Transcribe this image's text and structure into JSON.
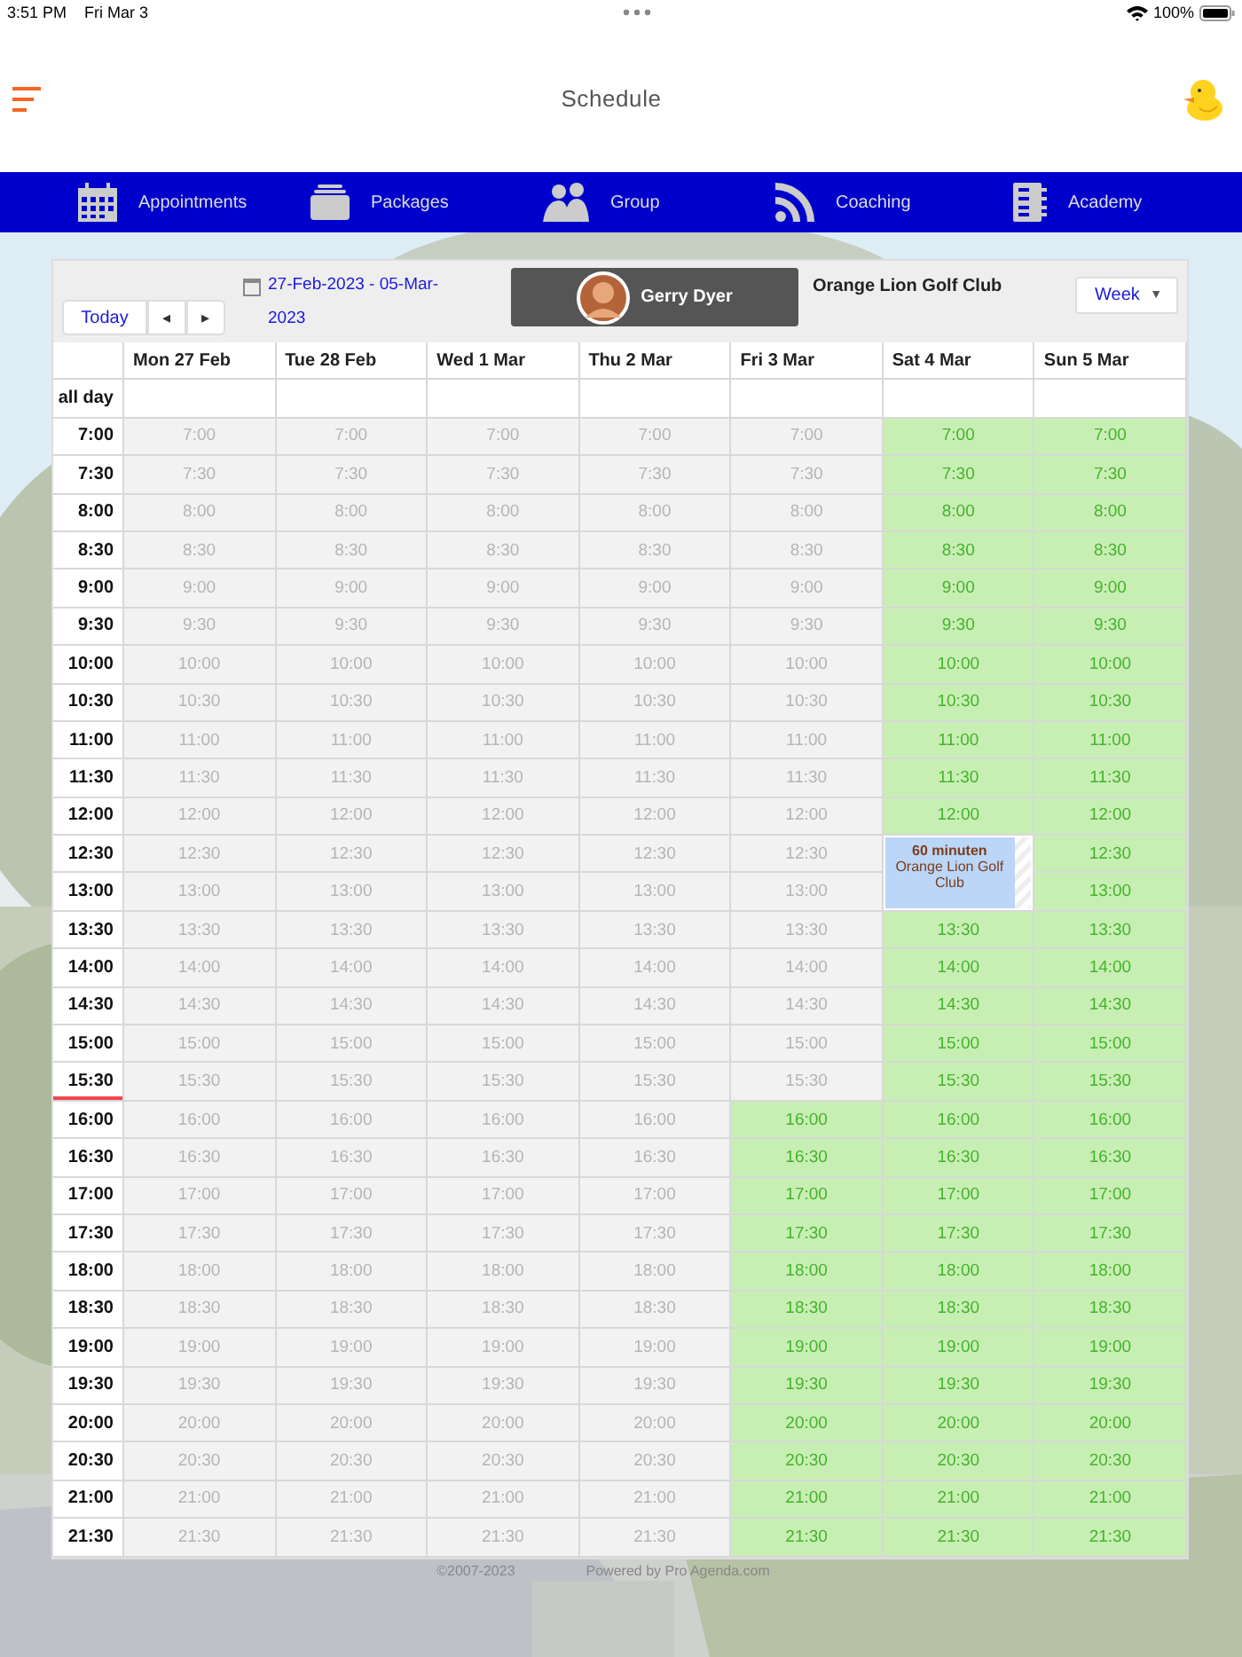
{
  "status_bar": {
    "time": "3:51 PM",
    "date": "Fri Mar 3",
    "battery": "100%"
  },
  "header": {
    "title": "Schedule"
  },
  "nav": [
    {
      "label": "Appointments"
    },
    {
      "label": "Packages"
    },
    {
      "label": "Group"
    },
    {
      "label": "Coaching"
    },
    {
      "label": "Academy"
    }
  ],
  "toolbar": {
    "today": "Today",
    "prev": "◂",
    "next": "▸",
    "range": "27-Feb-2023 - 05-Mar-2023",
    "person": "Gerry Dyer",
    "club": "Orange Lion Golf Club",
    "view": "Week",
    "view_caret": "▼"
  },
  "calendar": {
    "columns": [
      "Mon 27 Feb",
      "Tue 28 Feb",
      "Wed 1 Mar",
      "Thu 2 Mar",
      "Fri 3 Mar",
      "Sat 4 Mar",
      "Sun 5 Mar"
    ],
    "all_day": "all day",
    "rows": [
      {
        "time": "7:00",
        "now": false,
        "cells": [
          {
            "text": "7:00",
            "open": false
          },
          {
            "text": "7:00",
            "open": false
          },
          {
            "text": "7:00",
            "open": false
          },
          {
            "text": "7:00",
            "open": false
          },
          {
            "text": "7:00",
            "open": false
          },
          {
            "text": "7:00",
            "open": true
          },
          {
            "text": "7:00",
            "open": true
          }
        ]
      },
      {
        "time": "7:30",
        "now": false,
        "cells": [
          {
            "text": "7:30",
            "open": false
          },
          {
            "text": "7:30",
            "open": false
          },
          {
            "text": "7:30",
            "open": false
          },
          {
            "text": "7:30",
            "open": false
          },
          {
            "text": "7:30",
            "open": false
          },
          {
            "text": "7:30",
            "open": true
          },
          {
            "text": "7:30",
            "open": true
          }
        ]
      },
      {
        "time": "8:00",
        "now": false,
        "cells": [
          {
            "text": "8:00",
            "open": false
          },
          {
            "text": "8:00",
            "open": false
          },
          {
            "text": "8:00",
            "open": false
          },
          {
            "text": "8:00",
            "open": false
          },
          {
            "text": "8:00",
            "open": false
          },
          {
            "text": "8:00",
            "open": true
          },
          {
            "text": "8:00",
            "open": true
          }
        ]
      },
      {
        "time": "8:30",
        "now": false,
        "cells": [
          {
            "text": "8:30",
            "open": false
          },
          {
            "text": "8:30",
            "open": false
          },
          {
            "text": "8:30",
            "open": false
          },
          {
            "text": "8:30",
            "open": false
          },
          {
            "text": "8:30",
            "open": false
          },
          {
            "text": "8:30",
            "open": true
          },
          {
            "text": "8:30",
            "open": true
          }
        ]
      },
      {
        "time": "9:00",
        "now": false,
        "cells": [
          {
            "text": "9:00",
            "open": false
          },
          {
            "text": "9:00",
            "open": false
          },
          {
            "text": "9:00",
            "open": false
          },
          {
            "text": "9:00",
            "open": false
          },
          {
            "text": "9:00",
            "open": false
          },
          {
            "text": "9:00",
            "open": true
          },
          {
            "text": "9:00",
            "open": true
          }
        ]
      },
      {
        "time": "9:30",
        "now": false,
        "cells": [
          {
            "text": "9:30",
            "open": false
          },
          {
            "text": "9:30",
            "open": false
          },
          {
            "text": "9:30",
            "open": false
          },
          {
            "text": "9:30",
            "open": false
          },
          {
            "text": "9:30",
            "open": false
          },
          {
            "text": "9:30",
            "open": true
          },
          {
            "text": "9:30",
            "open": true
          }
        ]
      },
      {
        "time": "10:00",
        "now": false,
        "cells": [
          {
            "text": "10:00",
            "open": false
          },
          {
            "text": "10:00",
            "open": false
          },
          {
            "text": "10:00",
            "open": false
          },
          {
            "text": "10:00",
            "open": false
          },
          {
            "text": "10:00",
            "open": false
          },
          {
            "text": "10:00",
            "open": true
          },
          {
            "text": "10:00",
            "open": true
          }
        ]
      },
      {
        "time": "10:30",
        "now": false,
        "cells": [
          {
            "text": "10:30",
            "open": false
          },
          {
            "text": "10:30",
            "open": false
          },
          {
            "text": "10:30",
            "open": false
          },
          {
            "text": "10:30",
            "open": false
          },
          {
            "text": "10:30",
            "open": false
          },
          {
            "text": "10:30",
            "open": true
          },
          {
            "text": "10:30",
            "open": true
          }
        ]
      },
      {
        "time": "11:00",
        "now": false,
        "cells": [
          {
            "text": "11:00",
            "open": false
          },
          {
            "text": "11:00",
            "open": false
          },
          {
            "text": "11:00",
            "open": false
          },
          {
            "text": "11:00",
            "open": false
          },
          {
            "text": "11:00",
            "open": false
          },
          {
            "text": "11:00",
            "open": true
          },
          {
            "text": "11:00",
            "open": true
          }
        ]
      },
      {
        "time": "11:30",
        "now": false,
        "cells": [
          {
            "text": "11:30",
            "open": false
          },
          {
            "text": "11:30",
            "open": false
          },
          {
            "text": "11:30",
            "open": false
          },
          {
            "text": "11:30",
            "open": false
          },
          {
            "text": "11:30",
            "open": false
          },
          {
            "text": "11:30",
            "open": true
          },
          {
            "text": "11:30",
            "open": true
          }
        ]
      },
      {
        "time": "12:00",
        "now": false,
        "cells": [
          {
            "text": "12:00",
            "open": false
          },
          {
            "text": "12:00",
            "open": false
          },
          {
            "text": "12:00",
            "open": false
          },
          {
            "text": "12:00",
            "open": false
          },
          {
            "text": "12:00",
            "open": false
          },
          {
            "text": "12:00",
            "open": true
          },
          {
            "text": "12:00",
            "open": true
          }
        ]
      },
      {
        "time": "12:30",
        "now": false,
        "cells": [
          {
            "text": "12:30",
            "open": false
          },
          {
            "text": "12:30",
            "open": false
          },
          {
            "text": "12:30",
            "open": false
          },
          {
            "text": "12:30",
            "open": false
          },
          {
            "text": "12:30",
            "open": false
          },
          {
            "kind": "event",
            "title": "60 minuten",
            "place": "Orange Lion Golf Club"
          },
          {
            "text": "12:30",
            "open": true
          }
        ]
      },
      {
        "time": "13:00",
        "now": false,
        "cells": [
          {
            "text": "13:00",
            "open": false
          },
          {
            "text": "13:00",
            "open": false
          },
          {
            "text": "13:00",
            "open": false
          },
          {
            "text": "13:00",
            "open": false
          },
          {
            "text": "13:00",
            "open": false
          },
          "",
          {
            "text": "13:00",
            "open": true
          }
        ]
      },
      {
        "time": "13:30",
        "now": false,
        "cells": [
          {
            "text": "13:30",
            "open": false
          },
          {
            "text": "13:30",
            "open": false
          },
          {
            "text": "13:30",
            "open": false
          },
          {
            "text": "13:30",
            "open": false
          },
          {
            "text": "13:30",
            "open": false
          },
          {
            "text": "13:30",
            "open": true
          },
          {
            "text": "13:30",
            "open": true
          }
        ]
      },
      {
        "time": "14:00",
        "now": false,
        "cells": [
          {
            "text": "14:00",
            "open": false
          },
          {
            "text": "14:00",
            "open": false
          },
          {
            "text": "14:00",
            "open": false
          },
          {
            "text": "14:00",
            "open": false
          },
          {
            "text": "14:00",
            "open": false
          },
          {
            "text": "14:00",
            "open": true
          },
          {
            "text": "14:00",
            "open": true
          }
        ]
      },
      {
        "time": "14:30",
        "now": false,
        "cells": [
          {
            "text": "14:30",
            "open": false
          },
          {
            "text": "14:30",
            "open": false
          },
          {
            "text": "14:30",
            "open": false
          },
          {
            "text": "14:30",
            "open": false
          },
          {
            "text": "14:30",
            "open": false
          },
          {
            "text": "14:30",
            "open": true
          },
          {
            "text": "14:30",
            "open": true
          }
        ]
      },
      {
        "time": "15:00",
        "now": false,
        "cells": [
          {
            "text": "15:00",
            "open": false
          },
          {
            "text": "15:00",
            "open": false
          },
          {
            "text": "15:00",
            "open": false
          },
          {
            "text": "15:00",
            "open": false
          },
          {
            "text": "15:00",
            "open": false
          },
          {
            "text": "15:00",
            "open": true
          },
          {
            "text": "15:00",
            "open": true
          }
        ]
      },
      {
        "time": "15:30",
        "now": true,
        "cells": [
          {
            "text": "15:30",
            "open": false
          },
          {
            "text": "15:30",
            "open": false
          },
          {
            "text": "15:30",
            "open": false
          },
          {
            "text": "15:30",
            "open": false
          },
          {
            "text": "15:30",
            "open": false
          },
          {
            "text": "15:30",
            "open": true
          },
          {
            "text": "15:30",
            "open": true
          }
        ]
      },
      {
        "time": "16:00",
        "now": false,
        "cells": [
          {
            "text": "16:00",
            "open": false
          },
          {
            "text": "16:00",
            "open": false
          },
          {
            "text": "16:00",
            "open": false
          },
          {
            "text": "16:00",
            "open": false
          },
          {
            "text": "16:00",
            "open": true
          },
          {
            "text": "16:00",
            "open": true
          },
          {
            "text": "16:00",
            "open": true
          }
        ]
      },
      {
        "time": "16:30",
        "now": false,
        "cells": [
          {
            "text": "16:30",
            "open": false
          },
          {
            "text": "16:30",
            "open": false
          },
          {
            "text": "16:30",
            "open": false
          },
          {
            "text": "16:30",
            "open": false
          },
          {
            "text": "16:30",
            "open": true
          },
          {
            "text": "16:30",
            "open": true
          },
          {
            "text": "16:30",
            "open": true
          }
        ]
      },
      {
        "time": "17:00",
        "now": false,
        "cells": [
          {
            "text": "17:00",
            "open": false
          },
          {
            "text": "17:00",
            "open": false
          },
          {
            "text": "17:00",
            "open": false
          },
          {
            "text": "17:00",
            "open": false
          },
          {
            "text": "17:00",
            "open": true
          },
          {
            "text": "17:00",
            "open": true
          },
          {
            "text": "17:00",
            "open": true
          }
        ]
      },
      {
        "time": "17:30",
        "now": false,
        "cells": [
          {
            "text": "17:30",
            "open": false
          },
          {
            "text": "17:30",
            "open": false
          },
          {
            "text": "17:30",
            "open": false
          },
          {
            "text": "17:30",
            "open": false
          },
          {
            "text": "17:30",
            "open": true
          },
          {
            "text": "17:30",
            "open": true
          },
          {
            "text": "17:30",
            "open": true
          }
        ]
      },
      {
        "time": "18:00",
        "now": false,
        "cells": [
          {
            "text": "18:00",
            "open": false
          },
          {
            "text": "18:00",
            "open": false
          },
          {
            "text": "18:00",
            "open": false
          },
          {
            "text": "18:00",
            "open": false
          },
          {
            "text": "18:00",
            "open": true
          },
          {
            "text": "18:00",
            "open": true
          },
          {
            "text": "18:00",
            "open": true
          }
        ]
      },
      {
        "time": "18:30",
        "now": false,
        "cells": [
          {
            "text": "18:30",
            "open": false
          },
          {
            "text": "18:30",
            "open": false
          },
          {
            "text": "18:30",
            "open": false
          },
          {
            "text": "18:30",
            "open": false
          },
          {
            "text": "18:30",
            "open": true
          },
          {
            "text": "18:30",
            "open": true
          },
          {
            "text": "18:30",
            "open": true
          }
        ]
      },
      {
        "time": "19:00",
        "now": false,
        "cells": [
          {
            "text": "19:00",
            "open": false
          },
          {
            "text": "19:00",
            "open": false
          },
          {
            "text": "19:00",
            "open": false
          },
          {
            "text": "19:00",
            "open": false
          },
          {
            "text": "19:00",
            "open": true
          },
          {
            "text": "19:00",
            "open": true
          },
          {
            "text": "19:00",
            "open": true
          }
        ]
      },
      {
        "time": "19:30",
        "now": false,
        "cells": [
          {
            "text": "19:30",
            "open": false
          },
          {
            "text": "19:30",
            "open": false
          },
          {
            "text": "19:30",
            "open": false
          },
          {
            "text": "19:30",
            "open": false
          },
          {
            "text": "19:30",
            "open": true
          },
          {
            "text": "19:30",
            "open": true
          },
          {
            "text": "19:30",
            "open": true
          }
        ]
      },
      {
        "time": "20:00",
        "now": false,
        "cells": [
          {
            "text": "20:00",
            "open": false
          },
          {
            "text": "20:00",
            "open": false
          },
          {
            "text": "20:00",
            "open": false
          },
          {
            "text": "20:00",
            "open": false
          },
          {
            "text": "20:00",
            "open": true
          },
          {
            "text": "20:00",
            "open": true
          },
          {
            "text": "20:00",
            "open": true
          }
        ]
      },
      {
        "time": "20:30",
        "now": false,
        "cells": [
          {
            "text": "20:30",
            "open": false
          },
          {
            "text": "20:30",
            "open": false
          },
          {
            "text": "20:30",
            "open": false
          },
          {
            "text": "20:30",
            "open": false
          },
          {
            "text": "20:30",
            "open": true
          },
          {
            "text": "20:30",
            "open": true
          },
          {
            "text": "20:30",
            "open": true
          }
        ]
      },
      {
        "time": "21:00",
        "now": false,
        "cells": [
          {
            "text": "21:00",
            "open": false
          },
          {
            "text": "21:00",
            "open": false
          },
          {
            "text": "21:00",
            "open": false
          },
          {
            "text": "21:00",
            "open": false
          },
          {
            "text": "21:00",
            "open": true
          },
          {
            "text": "21:00",
            "open": true
          },
          {
            "text": "21:00",
            "open": true
          }
        ]
      },
      {
        "time": "21:30",
        "now": false,
        "cells": [
          {
            "text": "21:30",
            "open": false
          },
          {
            "text": "21:30",
            "open": false
          },
          {
            "text": "21:30",
            "open": false
          },
          {
            "text": "21:30",
            "open": false
          },
          {
            "text": "21:30",
            "open": true
          },
          {
            "text": "21:30",
            "open": true
          },
          {
            "text": "21:30",
            "open": true
          }
        ]
      }
    ]
  },
  "footer": {
    "copyright": "©2007-2023",
    "powered": "Powered by Pro Agenda.com"
  }
}
